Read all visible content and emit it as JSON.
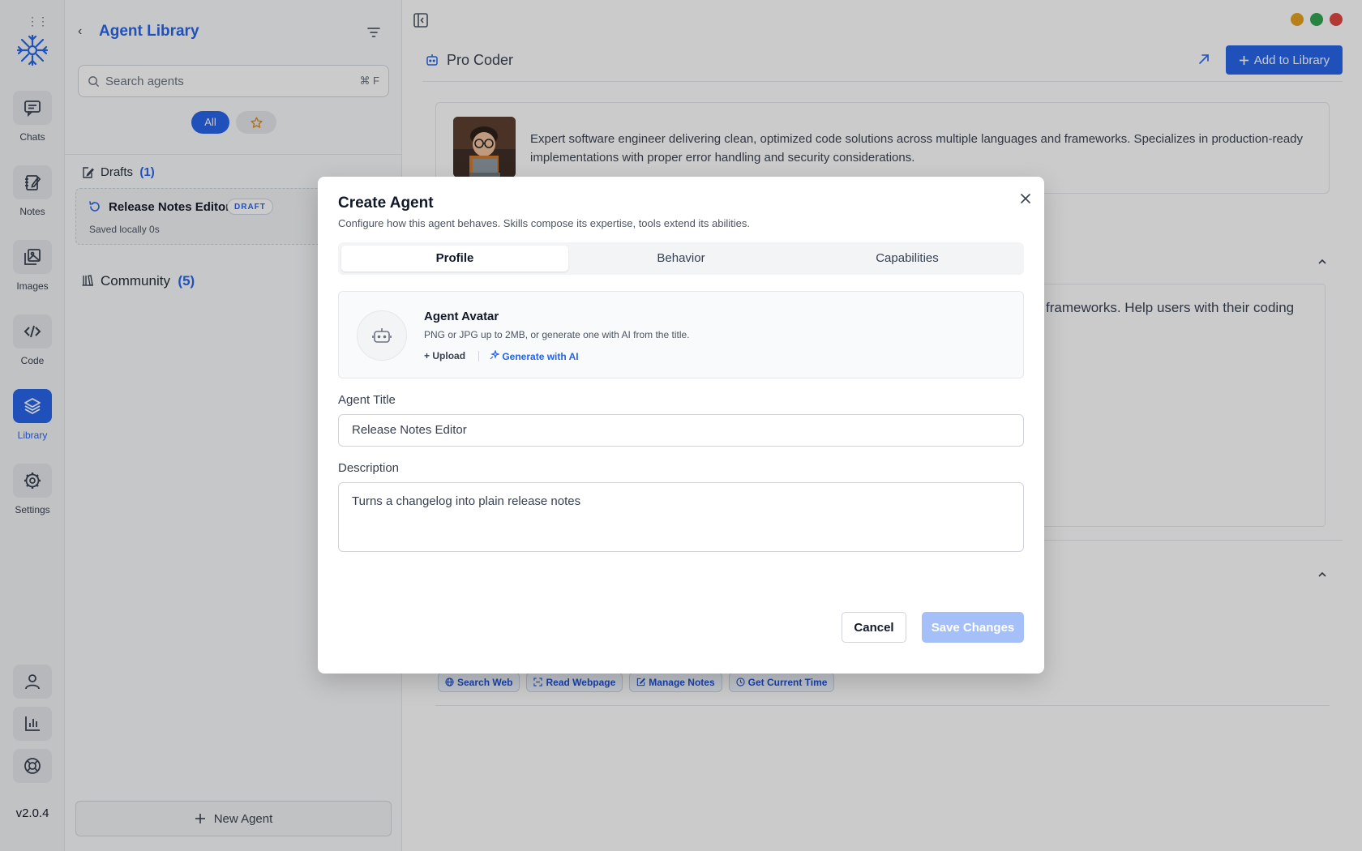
{
  "rail": {
    "items": [
      {
        "label": "Chats",
        "icon": "chat-icon"
      },
      {
        "label": "Notes",
        "icon": "notes-icon"
      },
      {
        "label": "Images",
        "icon": "images-icon"
      },
      {
        "label": "Code",
        "icon": "code-icon"
      },
      {
        "label": "Library",
        "icon": "layers-icon",
        "active": true
      },
      {
        "label": "Settings",
        "icon": "gear-icon"
      }
    ],
    "bottom_icons": [
      "user-icon",
      "chart-icon",
      "lifebuoy-icon"
    ],
    "version": "v2.0.4"
  },
  "library": {
    "back_glyph": "‹",
    "title": "Agent Library",
    "search": {
      "placeholder": "Search agents",
      "shortcut": "⌘ F"
    },
    "filters": {
      "all_label": "All",
      "starred_icon": "star-icon"
    },
    "drafts": {
      "label": "Drafts",
      "count": "(1)"
    },
    "draft_item": {
      "name": "Release Notes Editor",
      "badge": "DRAFT",
      "saved": "Saved locally 0s"
    },
    "community": {
      "label": "Community",
      "count": "(5)"
    },
    "new_agent_label": "New Agent"
  },
  "main": {
    "agent_name": "Pro Coder",
    "add_to_library_label": "Add to Library",
    "description": "Expert software engineer delivering clean, optimized code solutions across multiple languages and frameworks. Specializes in production-ready implementations with proper error handling and security considerations.",
    "prompt_fragment_line1": "frameworks. Help users with their coding",
    "tools": [
      "Search Web",
      "Read Webpage",
      "Manage Notes",
      "Get Current Time"
    ]
  },
  "window_controls": {
    "colors": [
      "#e6a11d",
      "#2fa44f",
      "#e0443e"
    ]
  },
  "modal": {
    "title": "Create Agent",
    "subtitle": "Configure how this agent behaves. Skills compose its expertise, tools extend its abilities.",
    "tabs": [
      "Profile",
      "Behavior",
      "Capabilities"
    ],
    "avatar": {
      "title": "Agent Avatar",
      "subtitle": "PNG or JPG up to 2MB, or generate one with AI from the title.",
      "upload_label": "Upload",
      "generate_label": "Generate with AI"
    },
    "agent_title_label": "Agent Title",
    "agent_title_value": "Release Notes Editor",
    "description_label": "Description",
    "description_value": "Turns a changelog into plain release notes",
    "cancel_label": "Cancel",
    "save_label": "Save Changes"
  },
  "colors": {
    "accent": "#2563eb",
    "save_disabled": "#a5c0f8"
  }
}
